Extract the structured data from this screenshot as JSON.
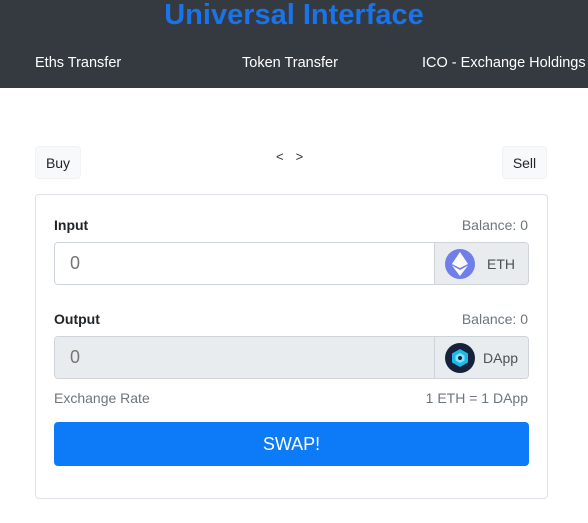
{
  "app": {
    "title": "Universal Interface"
  },
  "nav": {
    "eths_transfer": "Eths Transfer",
    "token_transfer": "Token Transfer",
    "ico_exchange": "ICO - Exchange Holdings"
  },
  "mode": {
    "buy_label": "Buy",
    "sell_label": "Sell",
    "prev_arrow": "<",
    "next_arrow": ">"
  },
  "swap": {
    "input": {
      "label": "Input",
      "balance": "Balance: 0",
      "placeholder": "0",
      "token": "ETH",
      "token_icon": "ethereum-icon"
    },
    "output": {
      "label": "Output",
      "balance": "Balance: 0",
      "placeholder": "0",
      "token": "DApp",
      "token_icon": "dapp-token-icon"
    },
    "rate_label": "Exchange Rate",
    "rate_value": "1 ETH = 1 DApp",
    "button_label": "SWAP!"
  },
  "colors": {
    "navbar": "#343a40",
    "title": "#1a73e8",
    "primary": "#0d7bf7",
    "eth_icon": "#6f7ee8",
    "dapp_icon": "#16223a"
  }
}
